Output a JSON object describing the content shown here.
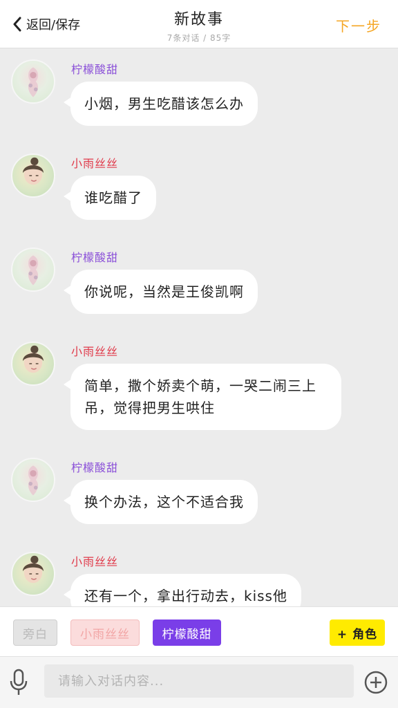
{
  "header": {
    "back_label": "返回/保存",
    "title": "新故事",
    "subtitle": "7条对话 / 85字",
    "next_label": "下一步"
  },
  "messages": [
    {
      "sender": "柠檬酸甜",
      "text": "小烟，男生吃醋该怎么办",
      "color": "#8a4fd8",
      "avatar": "lemon"
    },
    {
      "sender": "小雨丝丝",
      "text": "谁吃醋了",
      "color": "#e03a4a",
      "avatar": "rain"
    },
    {
      "sender": "柠檬酸甜",
      "text": "你说呢，当然是王俊凯啊",
      "color": "#8a4fd8",
      "avatar": "lemon"
    },
    {
      "sender": "小雨丝丝",
      "text": "简单，撒个娇卖个萌，一哭二闹三上吊，觉得把男生哄住",
      "color": "#e03a4a",
      "avatar": "rain"
    },
    {
      "sender": "柠檬酸甜",
      "text": "换个办法，这个不适合我",
      "color": "#8a4fd8",
      "avatar": "lemon"
    },
    {
      "sender": "小雨丝丝",
      "text": "还有一个，拿出行动去，kiss他",
      "color": "#e03a4a",
      "avatar": "rain"
    }
  ],
  "roles": {
    "narration": "旁白",
    "rain": "小雨丝丝",
    "lemon": "柠檬酸甜",
    "add": "+ 角色"
  },
  "input": {
    "placeholder": "请输入对话内容..."
  },
  "colors": {
    "accent_orange": "#f5a623",
    "lemon_purple": "#8a4fd8",
    "rain_red": "#e03a4a",
    "add_yellow": "#ffeb00"
  }
}
